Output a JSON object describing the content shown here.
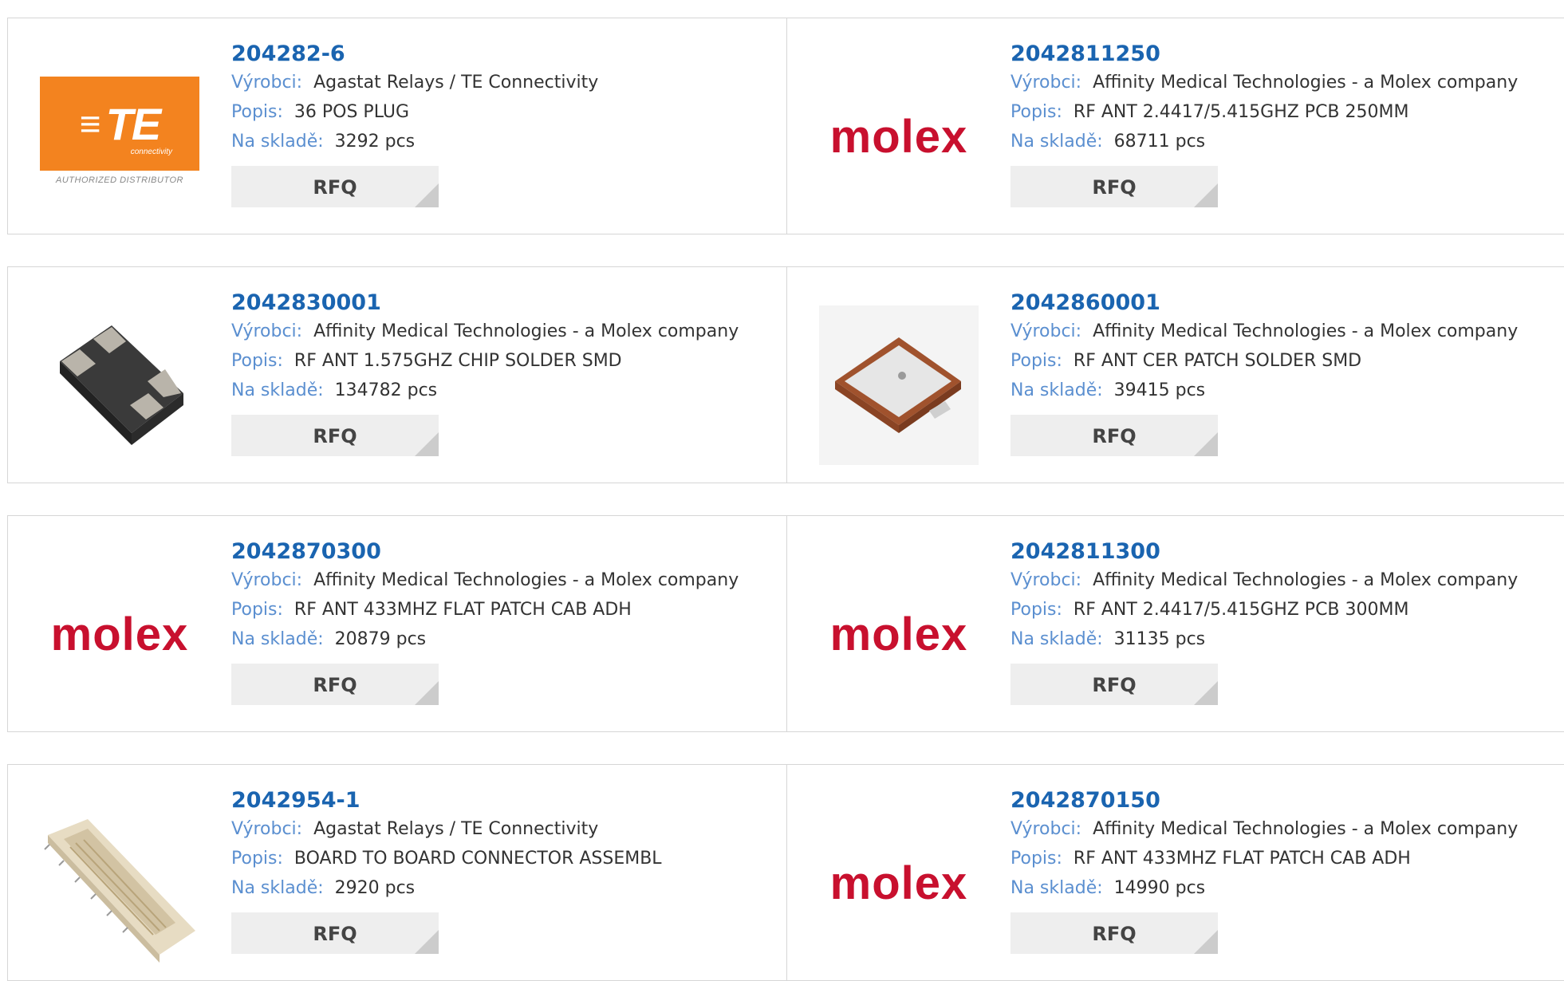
{
  "labels": {
    "manufacturer": "Výrobci:",
    "description": "Popis:",
    "stock": "Na skladě:",
    "rfq": "RFQ"
  },
  "logos": {
    "te_text": "TE",
    "te_sub": "connectivity",
    "te_distributor": "AUTHORIZED DISTRIBUTOR",
    "molex": "molex"
  },
  "colors": {
    "link": "#1a64b0",
    "label": "#5b8fd0",
    "te_orange": "#f3831f",
    "molex_red": "#c8102e"
  },
  "products": [
    {
      "part": "204282-6",
      "manufacturer": "Agastat Relays / TE Connectivity",
      "description": "36 POS PLUG",
      "stock": "3292 pcs",
      "image": "te-logo"
    },
    {
      "part": "2042811250",
      "manufacturer": "Affinity Medical Technologies - a Molex company",
      "description": "RF ANT 2.4417/5.415GHZ PCB 250MM",
      "stock": "68711 pcs",
      "image": "molex-logo"
    },
    {
      "part": "2042830001",
      "manufacturer": "Affinity Medical Technologies - a Molex company",
      "description": "RF ANT 1.575GHZ CHIP SOLDER SMD",
      "stock": "134782 pcs",
      "image": "chip-antenna"
    },
    {
      "part": "2042860001",
      "manufacturer": "Affinity Medical Technologies - a Molex company",
      "description": "RF ANT CER PATCH SOLDER SMD",
      "stock": "39415 pcs",
      "image": "patch-antenna"
    },
    {
      "part": "2042870300",
      "manufacturer": "Affinity Medical Technologies - a Molex company",
      "description": "RF ANT 433MHZ FLAT PATCH CAB ADH",
      "stock": "20879 pcs",
      "image": "molex-logo"
    },
    {
      "part": "2042811300",
      "manufacturer": "Affinity Medical Technologies - a Molex company",
      "description": "RF ANT 2.4417/5.415GHZ PCB 300MM",
      "stock": "31135 pcs",
      "image": "molex-logo"
    },
    {
      "part": "2042954-1",
      "manufacturer": "Agastat Relays / TE Connectivity",
      "description": "BOARD TO BOARD CONNECTOR ASSEMBL",
      "stock": "2920 pcs",
      "image": "connector"
    },
    {
      "part": "2042870150",
      "manufacturer": "Affinity Medical Technologies - a Molex company",
      "description": "RF ANT 433MHZ FLAT PATCH CAB ADH",
      "stock": "14990 pcs",
      "image": "molex-logo"
    }
  ]
}
